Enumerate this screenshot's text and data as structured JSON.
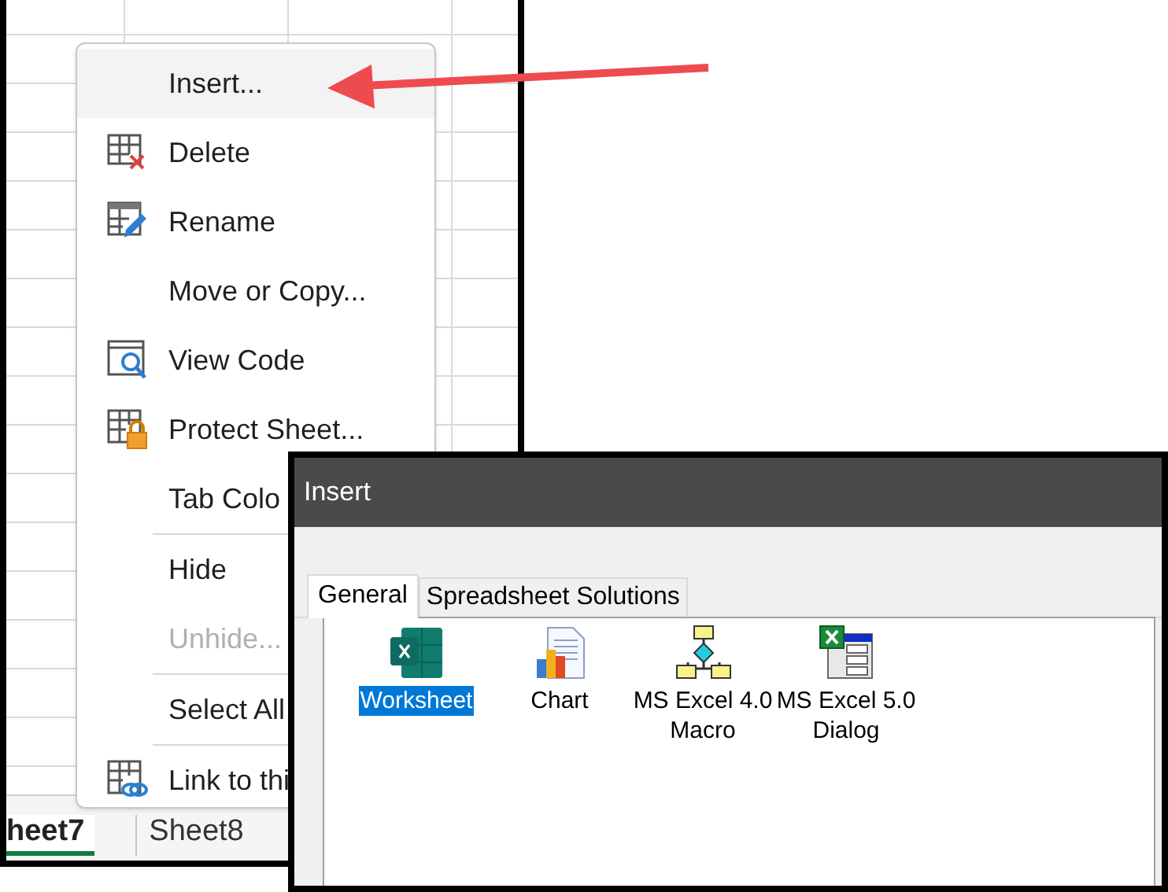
{
  "sheet_tabs": [
    {
      "label": "heet7",
      "selected": true
    },
    {
      "label": "Sheet8",
      "selected": false
    }
  ],
  "context_menu": {
    "items": [
      {
        "kind": "item",
        "label": "Insert...",
        "selected": true,
        "disabled": false
      },
      {
        "kind": "item",
        "label": "Delete",
        "selected": false,
        "disabled": false
      },
      {
        "kind": "item",
        "label": "Rename",
        "selected": false,
        "disabled": false
      },
      {
        "kind": "item",
        "label": "Move or Copy...",
        "selected": false,
        "disabled": false
      },
      {
        "kind": "item",
        "label": "View Code",
        "selected": false,
        "disabled": false
      },
      {
        "kind": "item",
        "label": "Protect Sheet...",
        "selected": false,
        "disabled": false
      },
      {
        "kind": "item",
        "label": "Tab Colo",
        "selected": false,
        "disabled": false
      },
      {
        "kind": "separator"
      },
      {
        "kind": "item",
        "label": "Hide",
        "selected": false,
        "disabled": false
      },
      {
        "kind": "item",
        "label": "Unhide...",
        "selected": false,
        "disabled": true
      },
      {
        "kind": "separator"
      },
      {
        "kind": "item",
        "label": "Select All",
        "selected": false,
        "disabled": false
      },
      {
        "kind": "separator"
      },
      {
        "kind": "item",
        "label": "Link to thi",
        "selected": false,
        "disabled": false
      }
    ]
  },
  "dialog": {
    "title": "Insert",
    "tabs": [
      {
        "label": "General",
        "selected": true
      },
      {
        "label": "Spreadsheet Solutions",
        "selected": false
      }
    ],
    "items": [
      {
        "label": "Worksheet",
        "selected": true
      },
      {
        "label": "Chart",
        "selected": false
      },
      {
        "label": "MS Excel 4.0 Macro",
        "selected": false
      },
      {
        "label": "MS Excel 5.0 Dialog",
        "selected": false
      }
    ]
  }
}
